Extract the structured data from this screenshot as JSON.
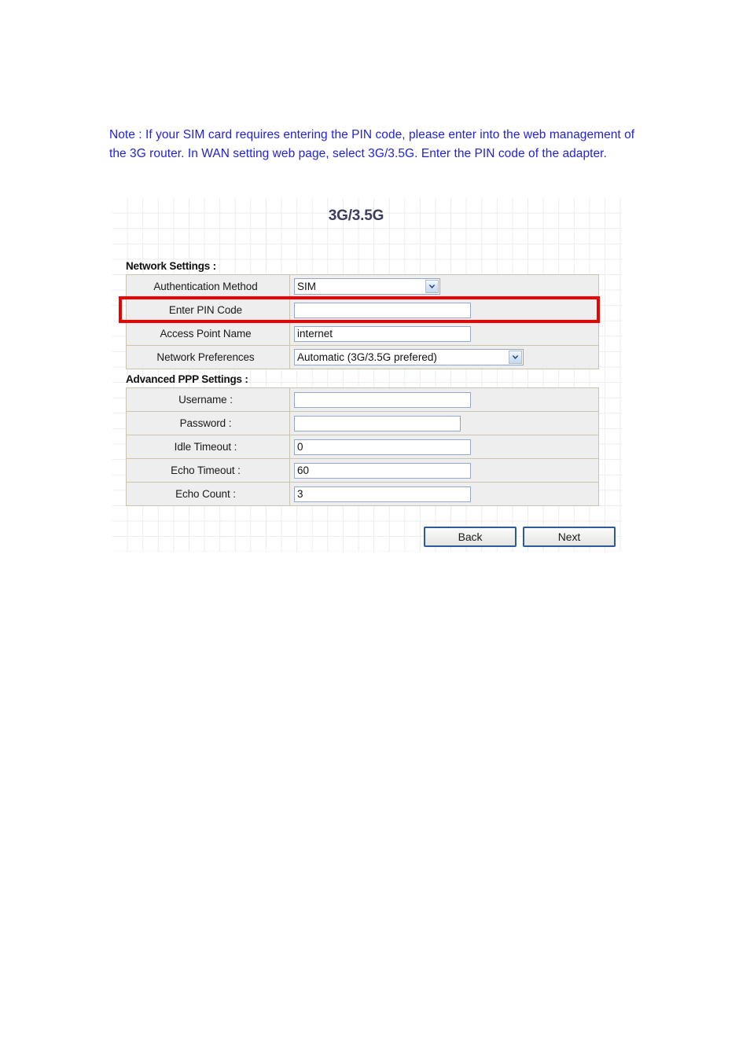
{
  "note": {
    "text": "Note : If your SIM card requires entering the PIN code, please enter into the web management of the 3G router. In WAN setting web page, select 3G/3.5G. Enter the PIN code of the adapter.",
    "color": "#2222dd"
  },
  "router_page": {
    "title": "3G/3.5G",
    "title_color": "#3c3c64",
    "highlight_color": "#ee0000",
    "sections": {
      "network": {
        "heading": "Network Settings :",
        "rows": [
          {
            "label": "Authentication Method",
            "control": "select",
            "value": "SIM",
            "highlighted": false
          },
          {
            "label": "Enter PIN Code",
            "control": "text",
            "value": "",
            "placeholder": "",
            "highlighted": true
          },
          {
            "label": "Access Point Name",
            "control": "text",
            "value": "internet",
            "placeholder": "",
            "highlighted": false
          },
          {
            "label": "Network Preferences",
            "control": "select",
            "value": "Automatic (3G/3.5G prefered)",
            "highlighted": false
          }
        ]
      },
      "ppp": {
        "heading": "Advanced PPP Settings :",
        "rows": [
          {
            "label": "Username :",
            "control": "text",
            "value": "",
            "placeholder": ""
          },
          {
            "label": "Password :",
            "control": "text",
            "value": "",
            "placeholder": ""
          },
          {
            "label": "Idle Timeout :",
            "control": "text",
            "value": "0",
            "placeholder": ""
          },
          {
            "label": "Echo Timeout :",
            "control": "text",
            "value": "60",
            "placeholder": ""
          },
          {
            "label": "Echo Count :",
            "control": "text",
            "value": "3",
            "placeholder": ""
          }
        ]
      }
    },
    "buttons": {
      "back": "Back",
      "next": "Next"
    }
  }
}
